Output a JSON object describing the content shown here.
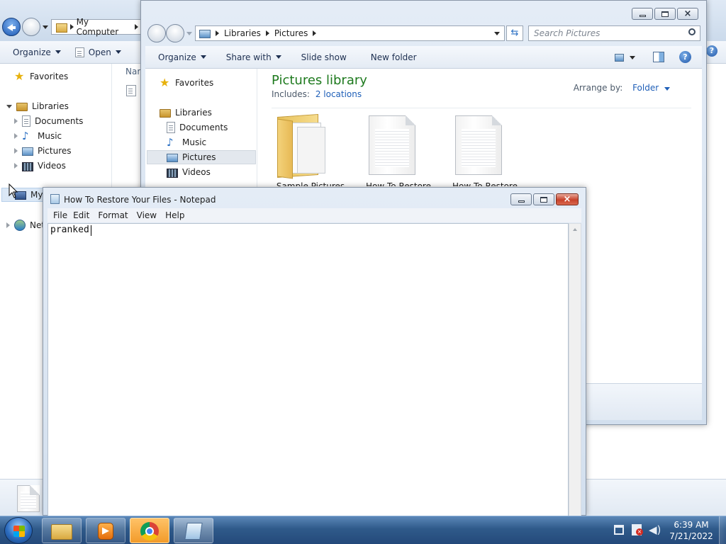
{
  "explorer_back": {
    "address": {
      "icon": "folder-icon",
      "location": "My Computer"
    },
    "toolbar": {
      "organize": "Organize",
      "open": "Open"
    },
    "column_header": "Nar",
    "nav": {
      "favorites": "Favorites",
      "libraries": "Libraries",
      "documents": "Documents",
      "music": "Music",
      "pictures": "Pictures",
      "videos": "Videos",
      "my_computer": "My",
      "network": "Net"
    }
  },
  "explorer_front": {
    "address": {
      "segments": [
        "Libraries",
        "Pictures"
      ]
    },
    "search_placeholder": "Search Pictures",
    "toolbar": {
      "organize": "Organize",
      "share_with": "Share with",
      "slide_show": "Slide show",
      "new_folder": "New folder"
    },
    "nav": {
      "favorites": "Favorites",
      "libraries": "Libraries",
      "documents": "Documents",
      "music": "Music",
      "pictures": "Pictures",
      "videos": "Videos"
    },
    "library": {
      "title": "Pictures library",
      "includes_label": "Includes:",
      "locations_link": "2 locations",
      "arrange_label": "Arrange by:",
      "arrange_value": "Folder"
    },
    "items": [
      {
        "name": "Sample Pictures"
      },
      {
        "name": "How To Restore"
      },
      {
        "name": "How To Restore"
      }
    ]
  },
  "notepad": {
    "title": "How To Restore Your Files - Notepad",
    "menu": [
      "File",
      "Edit",
      "Format",
      "View",
      "Help"
    ],
    "content": "pranked"
  },
  "taskbar": {
    "clock_time": "6:39 AM",
    "clock_date": "7/21/2022",
    "buttons": [
      "windows-explorer",
      "media-player",
      "chrome",
      "notepad"
    ]
  },
  "colors": {
    "library_title": "#1e7a1e",
    "link_blue": "#1f5fb8",
    "taskbar_active": "#f29b2a"
  }
}
